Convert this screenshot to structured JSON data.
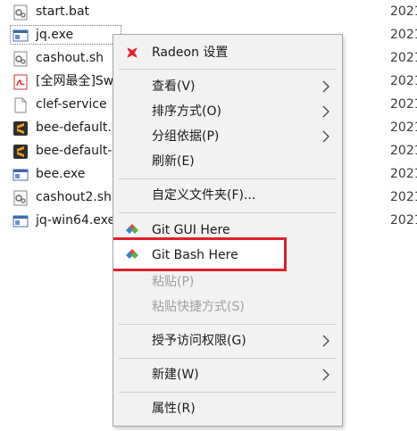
{
  "files": [
    {
      "name": "start.bat",
      "date": "2021",
      "icon": "gear-file-icon"
    },
    {
      "name": "jq.exe",
      "date": "2021",
      "icon": "exe-window-icon"
    },
    {
      "name": "cashout.sh",
      "date": "2021",
      "icon": "gear-file-icon"
    },
    {
      "name": "[全网最全]Sw",
      "date": "2021",
      "icon": "pdf-icon"
    },
    {
      "name": "clef-service",
      "date": "2021",
      "icon": "blank-file-icon"
    },
    {
      "name": "bee-default.",
      "date": "2021",
      "icon": "sublime-icon"
    },
    {
      "name": "bee-default-",
      "date": "2021",
      "icon": "sublime-icon"
    },
    {
      "name": "bee.exe",
      "date": "2021",
      "icon": "exe-window-icon"
    },
    {
      "name": "cashout2.sh",
      "date": "2021",
      "icon": "gear-file-icon"
    },
    {
      "name": "jq-win64.exe",
      "date": "2021",
      "icon": "exe-window-icon"
    }
  ],
  "menu": {
    "radeon": "Radeon 设置",
    "view": "查看(V)",
    "sort": "排序方式(O)",
    "group": "分组依据(P)",
    "refresh": "刷新(E)",
    "customize": "自定义文件夹(F)...",
    "git_gui": "Git GUI Here",
    "git_bash": "Git Bash Here",
    "paste": "粘贴(P)",
    "paste_shortcut": "粘贴快捷方式(S)",
    "grant_access": "授予访问权限(G)",
    "new": "新建(W)",
    "properties": "属性(R)"
  },
  "colors": {
    "highlight_border": "#e0202a",
    "radeon_red": "#e31b23",
    "git_blue": "#3b7fd4",
    "git_green": "#52b548",
    "git_red": "#e54b2e"
  }
}
